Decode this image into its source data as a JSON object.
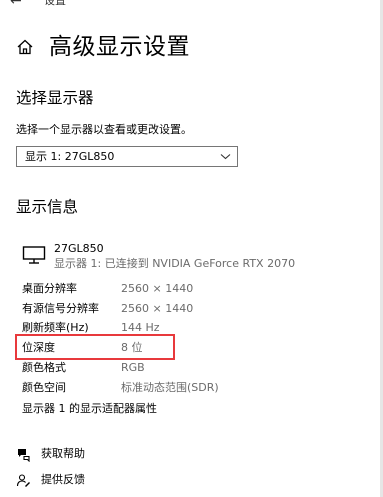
{
  "window": {
    "back_glyph": "←",
    "title": "设置"
  },
  "page": {
    "home_icon": "home-icon",
    "title": "高级显示设置"
  },
  "select_display": {
    "heading": "选择显示器",
    "description": "选择一个显示器以查看或更改设置。",
    "selected_value": "显示 1: 27GL850"
  },
  "display_info": {
    "heading": "显示信息",
    "monitor": {
      "name": "27GL850",
      "connection": "显示器 1: 已连接到 NVIDIA GeForce RTX 2070"
    },
    "rows": [
      {
        "label": "桌面分辨率",
        "value": "2560 × 1440"
      },
      {
        "label": "有源信号分辨率",
        "value": "2560 × 1440"
      },
      {
        "label": "刷新频率(Hz)",
        "value": "144 Hz"
      },
      {
        "label": "位深度",
        "value": "8 位"
      },
      {
        "label": "颜色格式",
        "value": "RGB"
      },
      {
        "label": "颜色空间",
        "value": "标准动态范围(SDR)"
      }
    ],
    "adapter_link": "显示器 1 的显示适配器属性"
  },
  "links": {
    "help": "获取帮助",
    "feedback": "提供反馈"
  },
  "colors": {
    "highlight": "#e8393c",
    "secondary_text": "#6b6b6b"
  }
}
